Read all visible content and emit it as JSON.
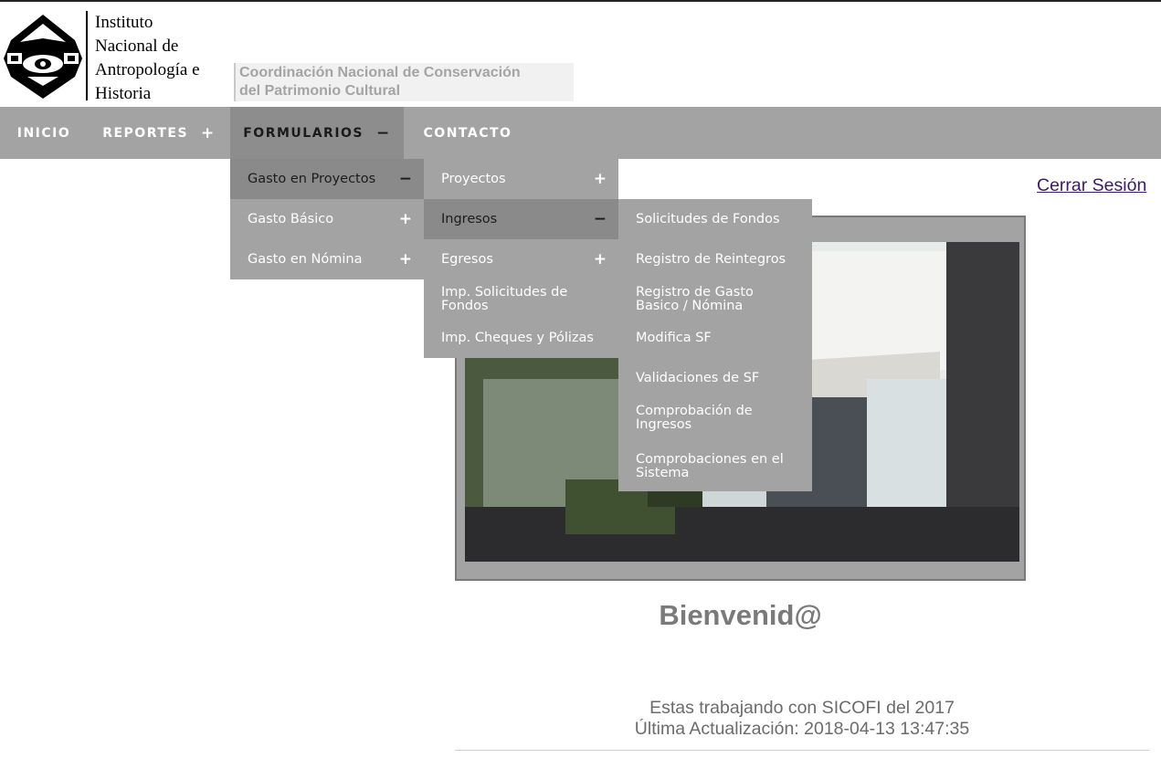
{
  "header": {
    "institute_lines": [
      "Instituto",
      "Nacional de",
      "Antropología e",
      "Historia"
    ],
    "coordination_lines": [
      "Coordinación Nacional de Conservación",
      "del Patrimonio Cultural"
    ],
    "logo_icon": "inah-logo-icon"
  },
  "nav": {
    "items": [
      {
        "label": "INICIO",
        "sign": ""
      },
      {
        "label": "REPORTES",
        "sign": "+"
      },
      {
        "label": "FORMULARIOS",
        "sign": "−"
      },
      {
        "label": "CONTACTO",
        "sign": ""
      }
    ],
    "active_item": "FORMULARIOS"
  },
  "menu_formularios": [
    {
      "label": "Gasto en Proyectos",
      "sign": "−"
    },
    {
      "label": "Gasto Básico",
      "sign": "+"
    },
    {
      "label": "Gasto en Nómina",
      "sign": "+"
    }
  ],
  "menu_proyectos": [
    {
      "label": "Proyectos",
      "sign": "+"
    },
    {
      "label": "Ingresos",
      "sign": "−"
    },
    {
      "label": "Egresos",
      "sign": "+"
    },
    {
      "label": "Imp. Solicitudes de Fondos",
      "sign": ""
    },
    {
      "label": "Imp. Cheques y Pólizas",
      "sign": ""
    }
  ],
  "menu_ingresos": [
    {
      "label": "Solicitudes de Fondos"
    },
    {
      "label": "Registro de Reintegros"
    },
    {
      "label": "Registro de Gasto Basico / Nómina"
    },
    {
      "label": "Modifica SF"
    },
    {
      "label": "Validaciones de SF"
    },
    {
      "label": "Comprobación de Ingresos"
    },
    {
      "label": "Comprobaciones en el Sistema"
    }
  ],
  "logout_label": "Cerrar Sesión",
  "welcome": "Bienvenid@",
  "info": {
    "line1": "Estas trabajando con SICOFI del 2017",
    "line2": "Última Actualización: 2018-04-13 13:47:35"
  },
  "colors": {
    "nav_bg": "#a3a3a3",
    "nav_active": "#8d8d8d",
    "menu_active": "#8a8a8a",
    "link": "#3b1a6b"
  }
}
